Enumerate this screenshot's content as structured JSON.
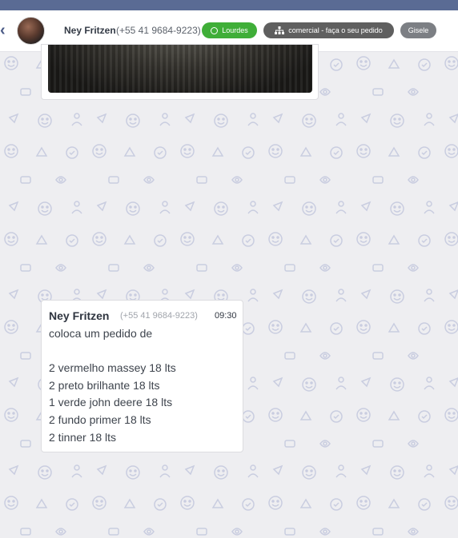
{
  "header": {
    "back_icon": "chevron-left-icon",
    "contact_name": "Ney Fritzen",
    "contact_phone": "(+55 41 9684-9223)",
    "tags": [
      {
        "label": "Lourdes",
        "icon": "whatsapp-icon",
        "color": "#3fae38"
      },
      {
        "label": "comercial - faça o seu pedido",
        "icon": "sitemap-icon",
        "color": "#5f5f5f"
      },
      {
        "label": "Gisele",
        "icon": "",
        "color": "#7c7f84"
      }
    ]
  },
  "messages": [
    {
      "sender_name": "Ney Fritzen",
      "sender_phone": "(+55 41 9684-9223)",
      "time": "09:30",
      "text": "coloca um pedido de\n\n2 vermelho massey 18 lts\n2 preto brilhante 18 lts\n1 verde john deere 18 lts\n2 fundo primer 18 lts\n2 tinner 18 lts"
    }
  ],
  "theme": {
    "top_bar": "#5a6b94",
    "chat_background": "#eeeef1",
    "pattern_icon_color": "#c9cde0"
  }
}
